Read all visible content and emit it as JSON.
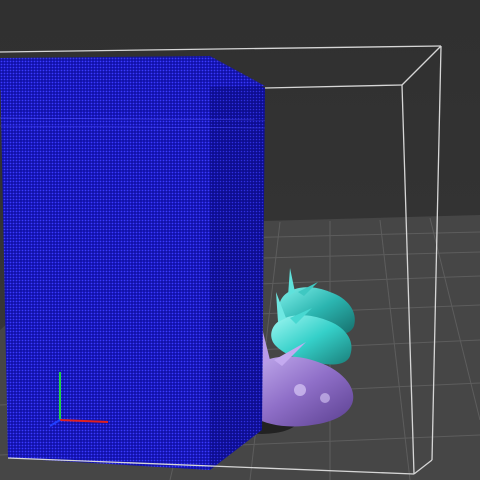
{
  "viewport": {
    "background_color": "#333333",
    "floor_color": "#474747",
    "grid_line_color": "#5e5e5e",
    "bounding_box_color": "#d8d8d8"
  },
  "fluid_block": {
    "color": "#1414b8",
    "particle_color": "#3a3aff"
  },
  "bunnies": [
    {
      "name": "bunny-teal",
      "color": "#2bb5b0"
    },
    {
      "name": "bunny-cyan",
      "color": "#3fd6cf"
    },
    {
      "name": "bunny-purple",
      "color": "#9b7fd0"
    }
  ],
  "axes_gizmo": {
    "x_color": "#e02020",
    "y_color": "#20d040",
    "z_color": "#2040ff"
  }
}
